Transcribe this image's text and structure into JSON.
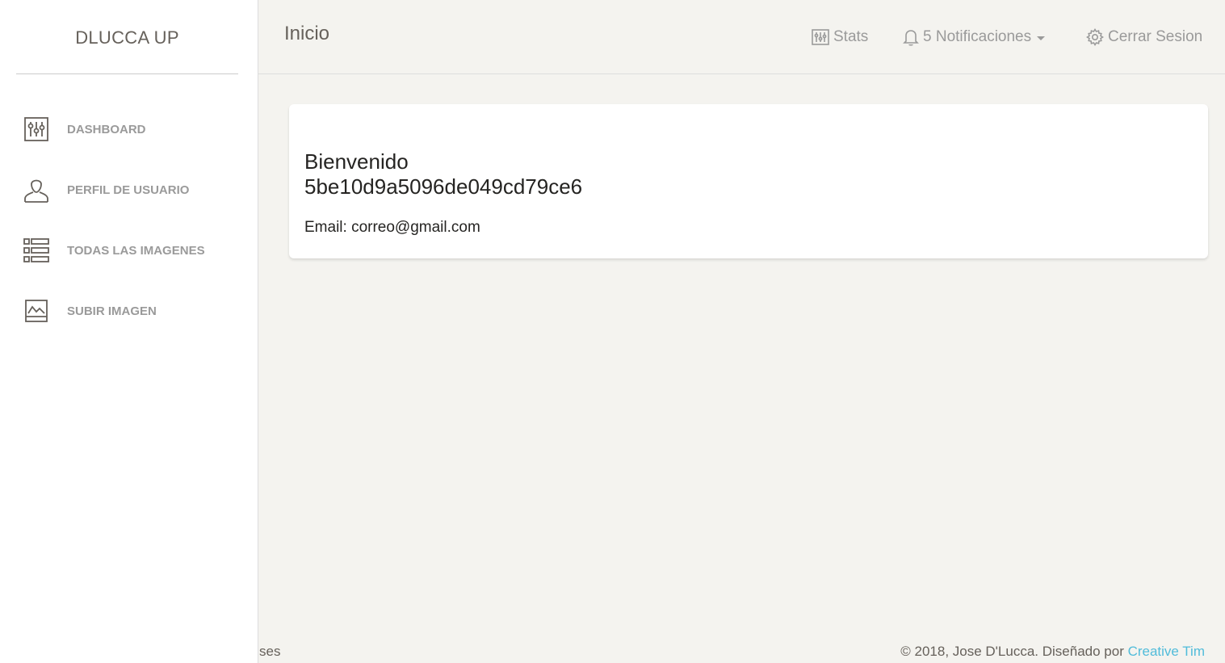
{
  "sidebar": {
    "brand": "DLUCCA UP",
    "items": [
      {
        "label": "DASHBOARD",
        "icon": "panel-icon"
      },
      {
        "label": "PERFIL DE USUARIO",
        "icon": "user-icon"
      },
      {
        "label": "TODAS LAS IMAGENES",
        "icon": "list-icon"
      },
      {
        "label": "SUBIR IMAGEN",
        "icon": "image-icon"
      }
    ]
  },
  "header": {
    "title": "Inicio",
    "stats_label": "Stats",
    "notifications_label": "5 Notificaciones",
    "logout_label": "Cerrar Sesion"
  },
  "card": {
    "greeting": "Bienvenido",
    "user_id": "5be10d9a5096de049cd79ce6",
    "email_text": "Email: correo@gmail.com"
  },
  "footer": {
    "left_text": "ses",
    "copyright": "© 2018, Jose D'Lucca. Diseñado por ",
    "credit_link": "Creative Tim"
  },
  "colors": {
    "background": "#f4f3ef",
    "sidebar": "#ffffff",
    "muted_text": "#9a9a9a",
    "link": "#51bcda"
  }
}
